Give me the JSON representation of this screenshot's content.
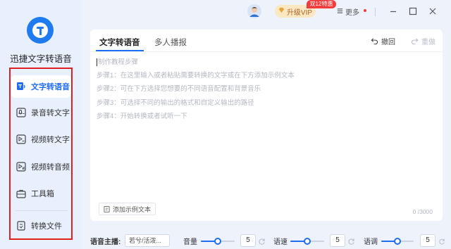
{
  "app": {
    "name": "迅捷文字转语音",
    "brand_color": "#1e7bf0"
  },
  "sidebar": {
    "items": [
      {
        "label": "文字转语音",
        "icon": "text-to-speech-icon",
        "active": true
      },
      {
        "label": "录音转文字",
        "icon": "recording-to-text-icon",
        "active": false
      },
      {
        "label": "视频转文字",
        "icon": "video-to-text-icon",
        "active": false
      },
      {
        "label": "视频转音频",
        "icon": "video-to-audio-icon",
        "active": false
      },
      {
        "label": "工具箱",
        "icon": "toolbox-icon",
        "active": false
      },
      {
        "label": "转换文件",
        "icon": "converted-files-icon",
        "active": false
      }
    ],
    "highlight_color": "#e02020"
  },
  "topbar": {
    "vip_label": "升级VIP",
    "vip_badge": "双12特惠",
    "more_label": "更多"
  },
  "editor": {
    "tabs": [
      {
        "label": "文字转语音",
        "active": true
      },
      {
        "label": "多人播报",
        "active": false
      }
    ],
    "undo_label": "撤回",
    "redo_label": "重做",
    "tutorial_title": "制作教程步骤",
    "steps": [
      "步骤1：在这里输入或者粘贴需要转换的文字或在下方添加示例文本",
      "步骤2：可在下方选择您想要的不同语音配置和背景音乐",
      "步骤3：可选择不同的输出的格式和自定义输出的路径",
      "步骤4：开始转换或者试听一下"
    ],
    "add_example_label": "添加示例文本",
    "char_count": "0 /3000"
  },
  "controls": {
    "anchor_label": "语音主播:",
    "anchor_value": "若兮/活泼...",
    "volume_label": "音量",
    "volume_value": "5",
    "volume_level": 0.5,
    "speed_label": "语速",
    "speed_value": "5",
    "speed_level": 0.5,
    "pitch_label": "语调",
    "pitch_value": "5",
    "pitch_level": 0.5
  }
}
